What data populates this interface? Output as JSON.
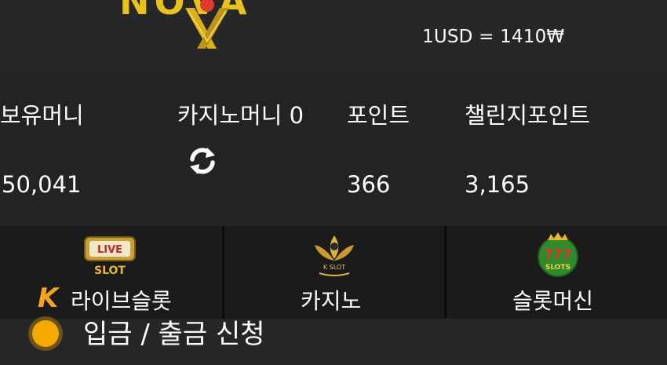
{
  "header": {
    "logo_text": "NOVA",
    "exchange_rate": "1USD = 1410₩"
  },
  "stats": {
    "items": [
      {
        "label": "보유머니",
        "value": "50,041"
      },
      {
        "label": "카지노머니 0",
        "value": ""
      },
      {
        "label": "포인트",
        "value": "366"
      },
      {
        "label": "챌린지포인트",
        "value": "3,165"
      }
    ],
    "refresh_icon": "refresh-icon"
  },
  "games": {
    "items": [
      {
        "label": "라이브슬롯",
        "icon": "live-slot-icon",
        "icon_text": "LIVE",
        "icon_sub": "SLOT",
        "badge": "K"
      },
      {
        "label": "카지노",
        "icon": "k-slot-lotus-icon",
        "icon_text": "K SLOT"
      },
      {
        "label": "슬롯머신",
        "icon": "777-slots-icon",
        "icon_text": "777",
        "icon_sub": "SLOTS"
      }
    ]
  },
  "request": {
    "label": "입금 / 출금 신청",
    "icon": "status-dot-icon"
  },
  "colors": {
    "background": "#262626",
    "panel": "#1b1b1b",
    "accent": "#f5a800",
    "logo_gold": "#e8c21a"
  }
}
